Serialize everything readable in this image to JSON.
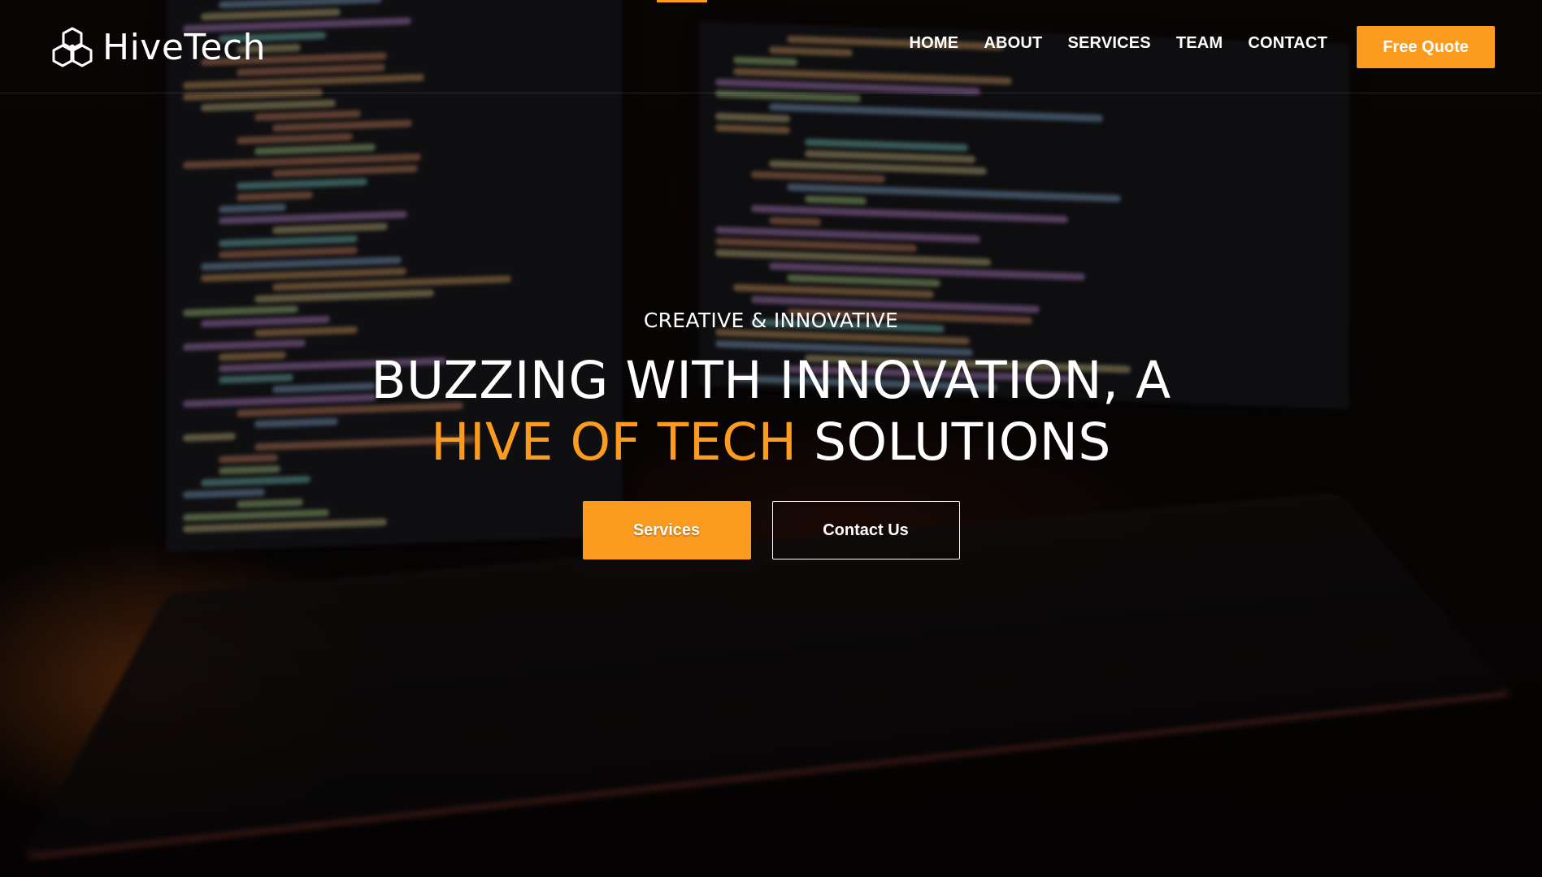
{
  "brand": {
    "name": "HiveTech",
    "logo_icon": "hexagon-bee-logo"
  },
  "nav": {
    "items": [
      {
        "label": "HOME"
      },
      {
        "label": "ABOUT"
      },
      {
        "label": "SERVICES"
      },
      {
        "label": "TEAM"
      },
      {
        "label": "CONTACT"
      }
    ],
    "quote_label": "Free Quote"
  },
  "hero": {
    "kicker": "CREATIVE & INNOVATIVE",
    "headline_line1": "BUZZING WITH INNOVATION, A",
    "headline_accent": "HIVE OF TECH",
    "headline_rest": " SOLUTIONS",
    "primary_cta": "Services",
    "secondary_cta": "Contact Us"
  },
  "colors": {
    "accent": "#fb9b1f",
    "text": "#ffffff",
    "background": "#0b0706"
  }
}
